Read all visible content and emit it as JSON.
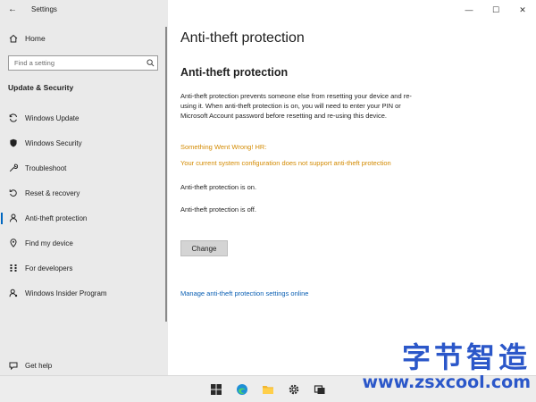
{
  "window": {
    "app_title": "Settings",
    "controls": {
      "minimize": "—",
      "maximize": "☐",
      "close": "✕"
    }
  },
  "sidebar": {
    "home_label": "Home",
    "search_placeholder": "Find a setting",
    "section_heading": "Update & Security",
    "items": [
      {
        "label": "Windows Update",
        "icon": "sync-icon"
      },
      {
        "label": "Windows Security",
        "icon": "shield-icon"
      },
      {
        "label": "Troubleshoot",
        "icon": "wrench-icon"
      },
      {
        "label": "Reset & recovery",
        "icon": "reset-icon"
      },
      {
        "label": "Anti-theft protection",
        "icon": "person-icon",
        "selected": true
      },
      {
        "label": "Find my device",
        "icon": "device-icon"
      },
      {
        "label": "For developers",
        "icon": "developer-icon"
      },
      {
        "label": "Windows Insider Program",
        "icon": "insider-icon"
      }
    ],
    "help_label": "Get help"
  },
  "main": {
    "page_title": "Anti-theft protection",
    "sub_title": "Anti-theft protection",
    "description": "Anti-theft protection prevents someone else from resetting your device and re-using it. When anti-theft protection is on, you will need to enter your PIN or Microsoft Account password before resetting and re-using this device.",
    "error_title": "Something Went Wrong! HR:",
    "error_message": "Your current system configuration does not support anti-theft protection",
    "status_on": "Anti-theft protection is on.",
    "status_off": "Anti-theft protection is off.",
    "change_button": "Change",
    "manage_link": "Manage anti-theft protection settings online"
  },
  "taskbar": {
    "icons": [
      "windows-start-icon",
      "edge-browser-icon",
      "file-explorer-icon",
      "settings-icon",
      "task-view-icon"
    ]
  },
  "watermark": {
    "chinese": "字节智造",
    "url": "www.zsxcool.com"
  },
  "colors": {
    "sidebar_bg": "#eaeaea",
    "accent": "#0067c0",
    "warning": "#d38a00",
    "link": "#0a5fb3",
    "watermark": "#2b57c9"
  }
}
